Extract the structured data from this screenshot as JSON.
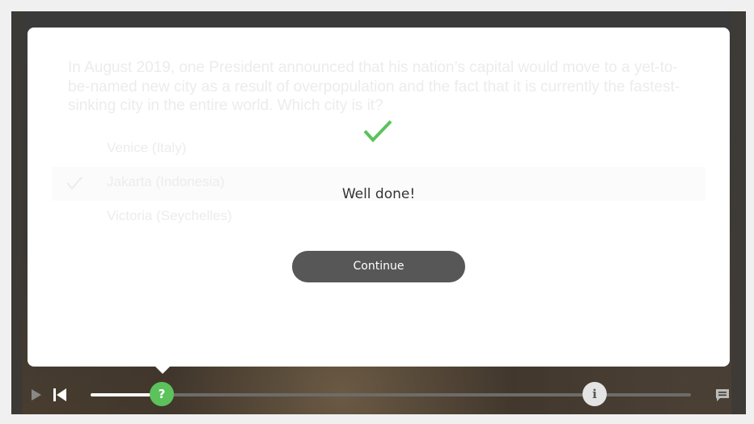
{
  "quiz": {
    "question": "In August 2019, one President announced that his nation’s capital would move to a yet-to-be-named new city as a result of overpopulation and the fact that it is currently the fastest-sinking city in the entire world. Which city is it?",
    "answers": [
      {
        "label": "Venice (Italy)",
        "selected": false
      },
      {
        "label": "Jakarta (Indonesia)",
        "selected": true
      },
      {
        "label": "Victoria (Seychelles)",
        "selected": false
      }
    ]
  },
  "feedback": {
    "icon": "checkmark-icon",
    "message": "Well done!",
    "continue_label": "Continue"
  },
  "player": {
    "progress": 0.12,
    "question_marker_label": "?",
    "info_marker_label": "i",
    "icons": [
      "play-icon",
      "restart-icon",
      "chat-icon"
    ]
  },
  "colors": {
    "success": "#5cc25c",
    "button": "#575757",
    "dialog_bg": "#ffffff"
  }
}
